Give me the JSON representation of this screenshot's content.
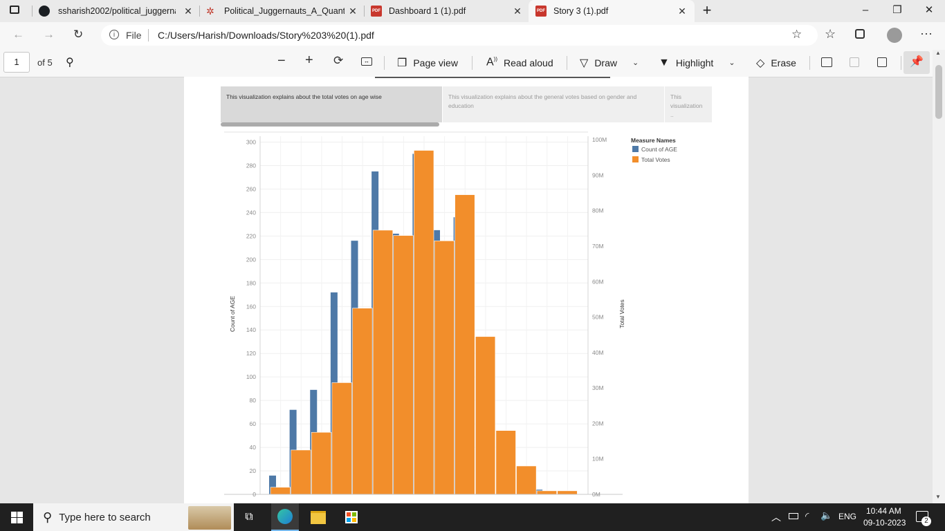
{
  "browser": {
    "tabs": [
      {
        "label": "ssharish2002/political_juggernau",
        "icon": "github-icon"
      },
      {
        "label": "Political_Juggernauts_A_Quantita",
        "icon": "app-icon"
      },
      {
        "label": "Dashboard 1 (1).pdf",
        "icon": "pdf-icon"
      },
      {
        "label": "Story 3 (1).pdf",
        "icon": "pdf-icon"
      }
    ],
    "active_tab": 3,
    "new_tab_symbol": "+",
    "file_label": "File",
    "url": "C:/Users/Harish/Downloads/Story%203%20(1).pdf"
  },
  "pdf_toolbar": {
    "page_number": "1",
    "page_total": "of 5",
    "page_view": "Page view",
    "read_aloud": "Read aloud",
    "draw": "Draw",
    "highlight": "Highlight",
    "erase": "Erase"
  },
  "story": {
    "captions": [
      "This visualization explains about the total votes on age wise",
      "This visualization explains about the general votes based on gender and education",
      "This visualization .."
    ]
  },
  "chart_data": {
    "type": "bar",
    "left_axis_label": "Count of AGE",
    "right_axis_label": "Total Votes",
    "left_ticks": [
      "0",
      "20",
      "40",
      "60",
      "80",
      "100",
      "120",
      "140",
      "160",
      "180",
      "200",
      "220",
      "240",
      "260",
      "280",
      "300"
    ],
    "right_ticks": [
      "0M",
      "10M",
      "20M",
      "30M",
      "40M",
      "50M",
      "60M",
      "70M",
      "80M",
      "90M",
      "100M"
    ],
    "left_ylim": [
      0,
      305
    ],
    "right_ylim": [
      0,
      101
    ],
    "legend_title": "Measure Names",
    "legend_position": "top-right",
    "series": [
      {
        "name": "Count of AGE",
        "color": "#4e79a7",
        "axis": "left",
        "values": [
          16,
          72,
          89,
          172,
          216,
          275,
          222,
          290,
          225,
          236,
          0,
          0,
          0,
          4,
          0,
          0
        ]
      },
      {
        "name": "Total Votes",
        "color": "#f28e2b",
        "axis": "right",
        "values": [
          2,
          12.5,
          17.5,
          31.5,
          52.5,
          74.5,
          73,
          97,
          71.5,
          84.5,
          44.5,
          18,
          8,
          1,
          1,
          0
        ]
      }
    ]
  },
  "taskbar": {
    "search_placeholder": "Type here to search",
    "language": "ENG",
    "time": "10:44 AM",
    "date": "09-10-2023",
    "notifications": "2"
  }
}
